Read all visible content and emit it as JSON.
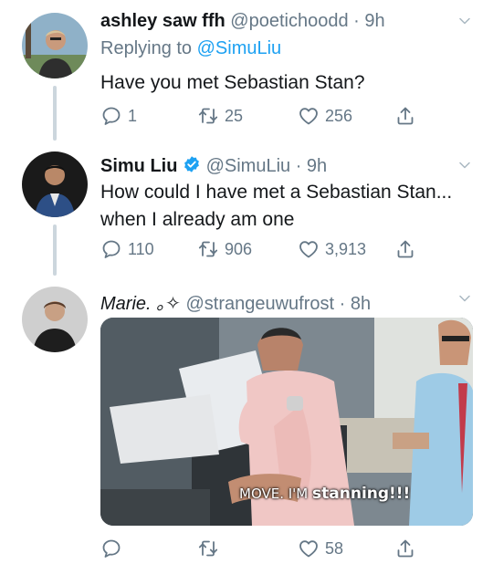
{
  "tweets": [
    {
      "display_name": "ashley saw ffh",
      "handle": "@poetichoodd",
      "time": "· 9h",
      "replying_prefix": "Replying to",
      "replying_handle": "@SimuLiu",
      "text": "Have you met Sebastian Stan?",
      "replies": "1",
      "retweets": "25",
      "likes": "256"
    },
    {
      "display_name": "Simu Liu",
      "handle": "@SimuLiu",
      "time": "· 9h",
      "verified": true,
      "text_line1": "How could I have met a Sebastian Stan...",
      "text_line2": "when I already am one",
      "replies": "110",
      "retweets": "906",
      "likes": "3,913"
    },
    {
      "display_name": "Marie. ｡✧",
      "handle": "@strangeuwufrost",
      "time": "· 8h",
      "media_caption_prefix": "MOVE. I'M ",
      "media_caption_bold": "stanning!!!",
      "replies": "",
      "retweets": "",
      "likes": "58"
    }
  ],
  "icons": {
    "reply": "reply-icon",
    "retweet": "retweet-icon",
    "like": "heart-icon",
    "share": "share-icon",
    "menu": "chevron-down-icon",
    "verified": "verified-badge-icon"
  },
  "colors": {
    "accent": "#1da1f2",
    "muted": "#657786",
    "text": "#14171a",
    "thread_line": "#ccd6dd"
  }
}
